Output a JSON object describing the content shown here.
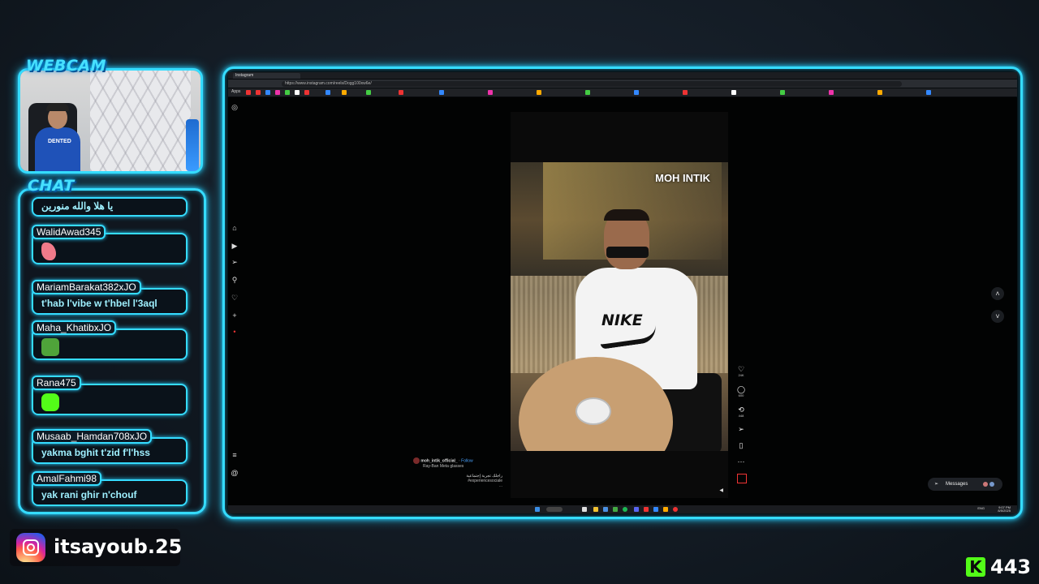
{
  "overlay": {
    "webcam_title": "WEBCAM",
    "chat_title": "CHAT",
    "accent_color": "#35dcff"
  },
  "webcam": {
    "shirt_text": "DENTED"
  },
  "chat": {
    "messages": [
      {
        "user": "",
        "text": "يا هلا والله منورين",
        "emote": ""
      },
      {
        "user": "WalidAwad345",
        "text": "",
        "emote": "praying-hands"
      },
      {
        "user": "MariamBarakat382xJO",
        "text": "t'hab l'vibe w t'hbel l'3aql",
        "emote": ""
      },
      {
        "user": "Maha_KhatibxJO",
        "text": "",
        "emote": "pepe"
      },
      {
        "user": "Rana475",
        "text": "",
        "emote": "green-face"
      },
      {
        "user": "Musaab_Hamdan708xJO",
        "text": "yakma bghit t'zid f'l'hss",
        "emote": ""
      },
      {
        "user": "AmalFahmi98",
        "text": "yak rani ghir n'chouf",
        "emote": ""
      }
    ]
  },
  "browser": {
    "tab_title": "Instagram",
    "url": "https://www.instagram.com/reels/Dogg100xw6e/",
    "bookmarks_label": "Apps"
  },
  "reel": {
    "watermark": "MOH INTIK",
    "shirt_brand": "NIKE",
    "author": "moh_intik_official_",
    "follow": "Follow",
    "audio": "Ray-Ban Meta glasses",
    "caption_line1": "راجلك تجربة إجتماعية",
    "caption_line2": "#experiencesociale",
    "caption_more": "...",
    "likes": "24K",
    "comments": "600",
    "reposts": "448"
  },
  "messages_pill": {
    "label": "Messages"
  },
  "clock": {
    "time": "9:07 PM",
    "date": "8/5/2025",
    "lang": "ENG"
  },
  "instagram_handle": "itsayoub.25",
  "kick": {
    "icon_letter": "K",
    "count": "443"
  }
}
